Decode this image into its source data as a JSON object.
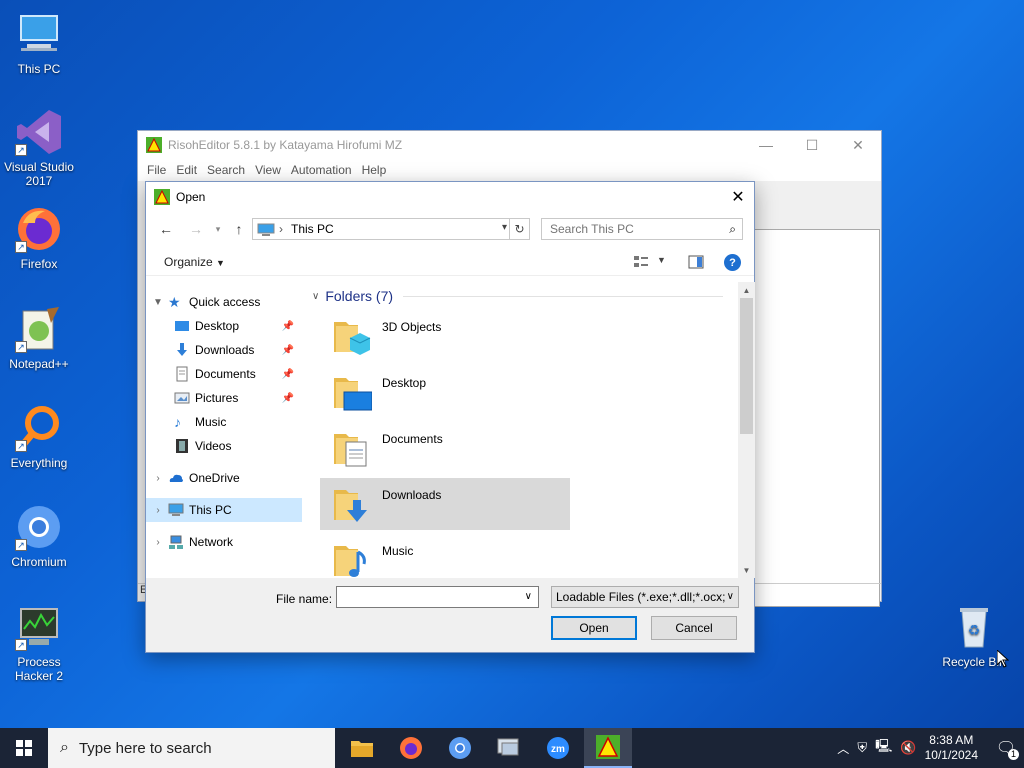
{
  "desktop": {
    "icons": [
      {
        "label": "This PC",
        "icon": "this-pc-icon"
      },
      {
        "label": "Visual Studio 2017",
        "icon": "visual-studio-icon"
      },
      {
        "label": "Firefox",
        "icon": "firefox-icon"
      },
      {
        "label": "Notepad++",
        "icon": "notepadpp-icon"
      },
      {
        "label": "Everything",
        "icon": "everything-icon"
      },
      {
        "label": "Chromium",
        "icon": "chromium-icon"
      },
      {
        "label": "Process Hacker 2",
        "icon": "process-hacker-icon"
      },
      {
        "label": "Recycle Bin",
        "icon": "recycle-bin-icon"
      }
    ]
  },
  "app": {
    "title": "RisohEditor 5.8.1 by Katayama Hirofumi MZ",
    "menu": [
      "File",
      "Edit",
      "Search",
      "View",
      "Automation",
      "Help"
    ],
    "status": "E"
  },
  "dialog": {
    "title": "Open",
    "address": {
      "root_label": "This PC"
    },
    "search": {
      "placeholder": "Search This PC"
    },
    "toolbar": {
      "organize": "Organize"
    },
    "nav": {
      "quick_access": "Quick access",
      "quick_items": [
        "Desktop",
        "Downloads",
        "Documents",
        "Pictures",
        "Music",
        "Videos"
      ],
      "onedrive": "OneDrive",
      "this_pc": "This PC",
      "network": "Network"
    },
    "content": {
      "group_header": "Folders (7)",
      "folders": [
        "3D Objects",
        "Desktop",
        "Documents",
        "Downloads",
        "Music"
      ]
    },
    "file_name": {
      "label": "File name:",
      "value": ""
    },
    "filter": "Loadable Files (*.exe;*.dll;*.ocx;",
    "buttons": {
      "open": "Open",
      "cancel": "Cancel"
    }
  },
  "taskbar": {
    "search_placeholder": "Type here to search",
    "apps": [
      "file-explorer-icon",
      "firefox-icon",
      "chromium-icon",
      "control-panel-icon",
      "zoom-icon",
      "risoheditor-icon"
    ],
    "clock": {
      "time": "8:38 AM",
      "date": "10/1/2024"
    },
    "notification_count": "1"
  },
  "colors": {
    "accent": "#0078d7",
    "selection": "#cce8ff",
    "taskbar": "#1b2436"
  }
}
